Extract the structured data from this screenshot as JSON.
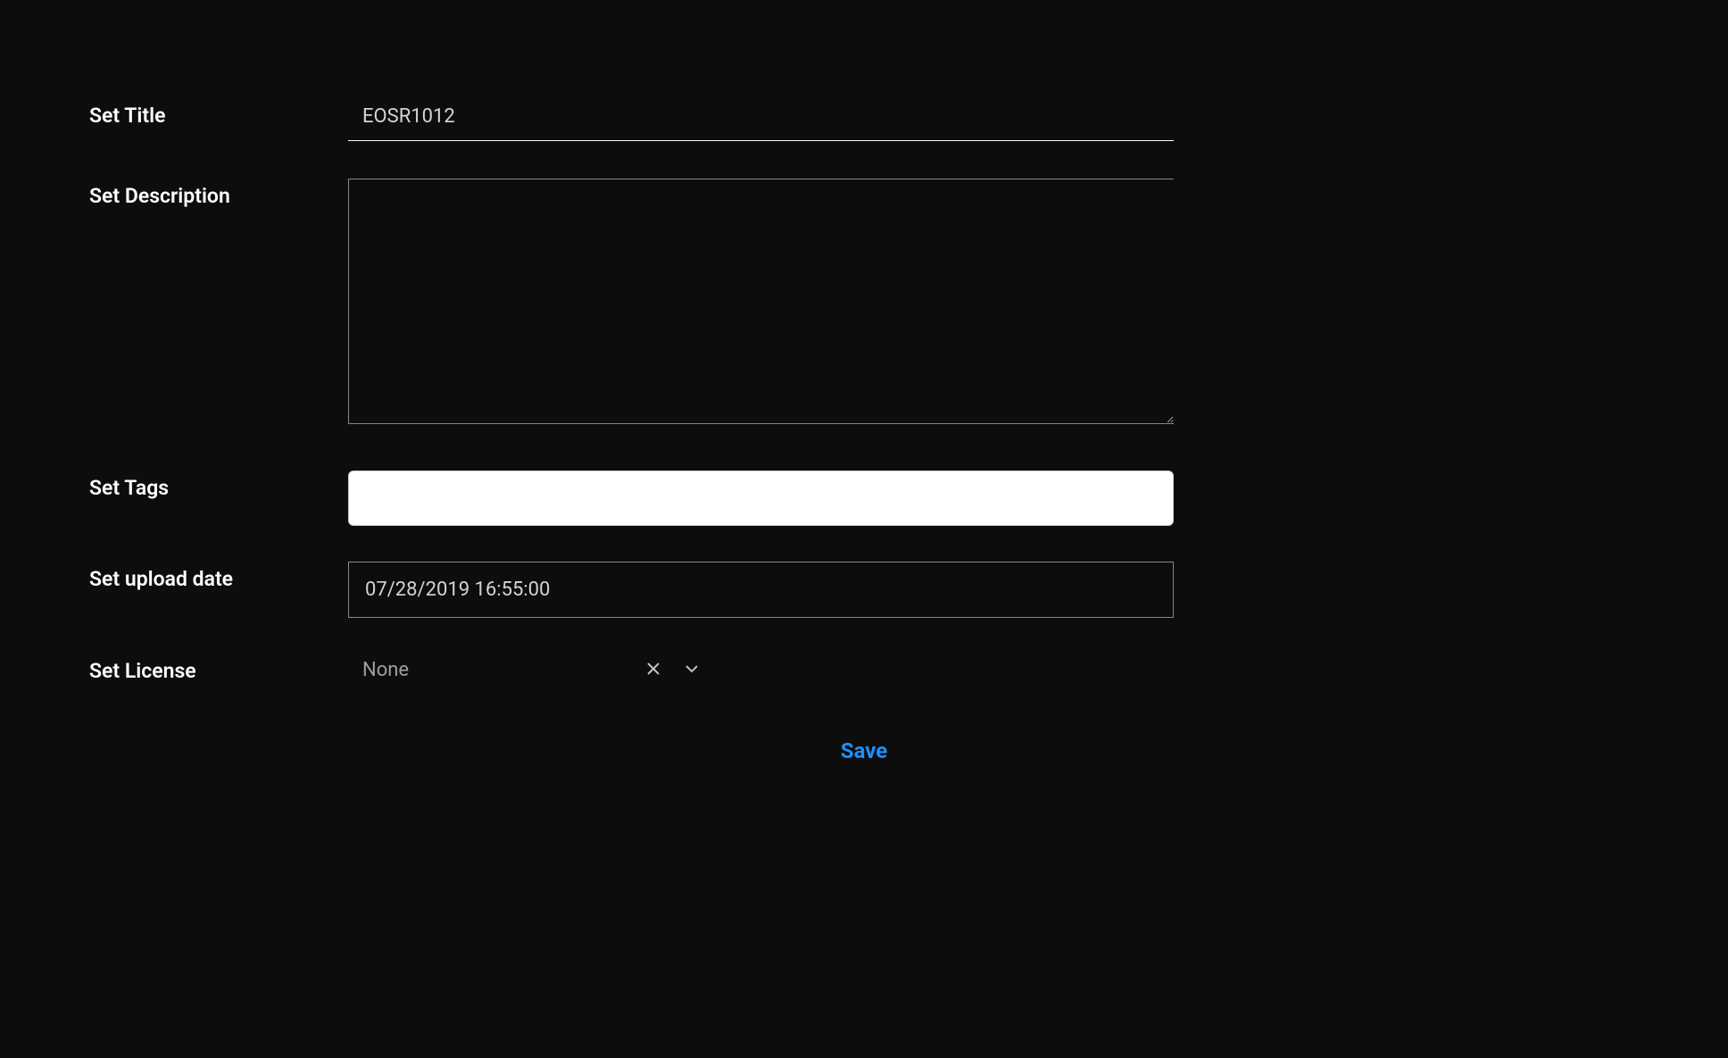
{
  "form": {
    "title": {
      "label": "Set Title",
      "value": "EOSR1012"
    },
    "description": {
      "label": "Set Description",
      "value": ""
    },
    "tags": {
      "label": "Set Tags",
      "value": ""
    },
    "upload_date": {
      "label": "Set upload date",
      "value": "07/28/2019 16:55:00"
    },
    "license": {
      "label": "Set License",
      "value": "None"
    },
    "save_label": "Save"
  }
}
